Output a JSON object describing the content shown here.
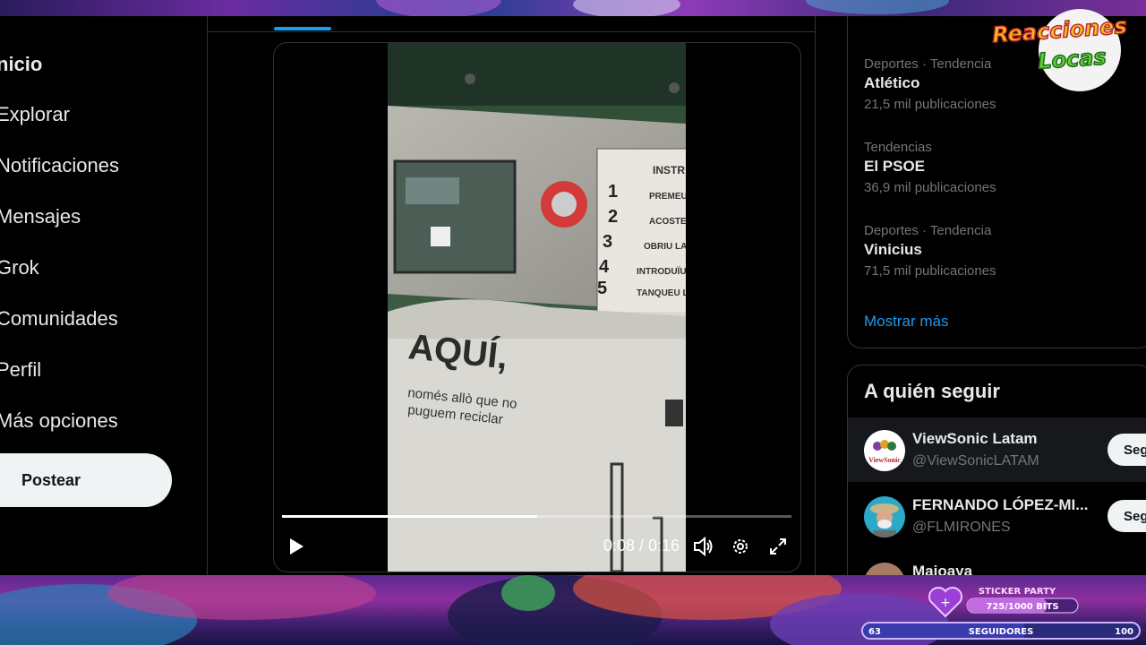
{
  "nav": {
    "items": [
      {
        "label": "nicio"
      },
      {
        "label": "Explorar"
      },
      {
        "label": "Notificaciones"
      },
      {
        "label": "Mensajes"
      },
      {
        "label": "Grok"
      },
      {
        "label": "Comunidades"
      },
      {
        "label": "Perfil"
      },
      {
        "label": "Más opciones"
      }
    ],
    "post_label": "Postear"
  },
  "video": {
    "current_time": "0:08",
    "duration": "0:16",
    "time_text": "0:08 / 0:16",
    "progress": 0.5,
    "sign_text": {
      "aqui": "AQUÍ,",
      "line1": "només allò que no",
      "line2": "puguem reciclar",
      "instr": "INSTR",
      "steps": [
        "PREMEU",
        "ACOSTEU",
        "OBRIU LA",
        "INTRODUÏU",
        "TANQUEU LA"
      ]
    }
  },
  "trends": [
    {
      "meta": "Deportes · Tendencia",
      "name": "Atlético",
      "count": "21,5 mil publicaciones"
    },
    {
      "meta": "Tendencias",
      "name": "El PSOE",
      "count": "36,9 mil publicaciones"
    },
    {
      "meta": "Deportes · Tendencia",
      "name": "Vinicius",
      "count": "71,5 mil publicaciones"
    }
  ],
  "show_more": "Mostrar más",
  "who_to_follow": {
    "title": "A quién seguir",
    "follow_label": "Seg",
    "accounts": [
      {
        "name": "ViewSonic Latam",
        "handle": "@ViewSonicLATAM",
        "avatar_text": "ViewSonic"
      },
      {
        "name": "FERNANDO LÓPEZ-MI...",
        "handle": "@FLMIRONES"
      },
      {
        "name": "Majoaya",
        "handle": ""
      }
    ]
  },
  "stream": {
    "logo_line1": "Reacciones",
    "logo_line2": "Locas",
    "sticker_title": "STICKER PARTY",
    "sticker_bits": "725/1000 BITS",
    "followers_current": "63",
    "followers_label": "SEGUIDORES",
    "followers_goal": "100"
  },
  "colors": {
    "accent": "#1d9bf0",
    "background": "#000000",
    "border": "#2f3336",
    "muted_text": "#71767b"
  }
}
